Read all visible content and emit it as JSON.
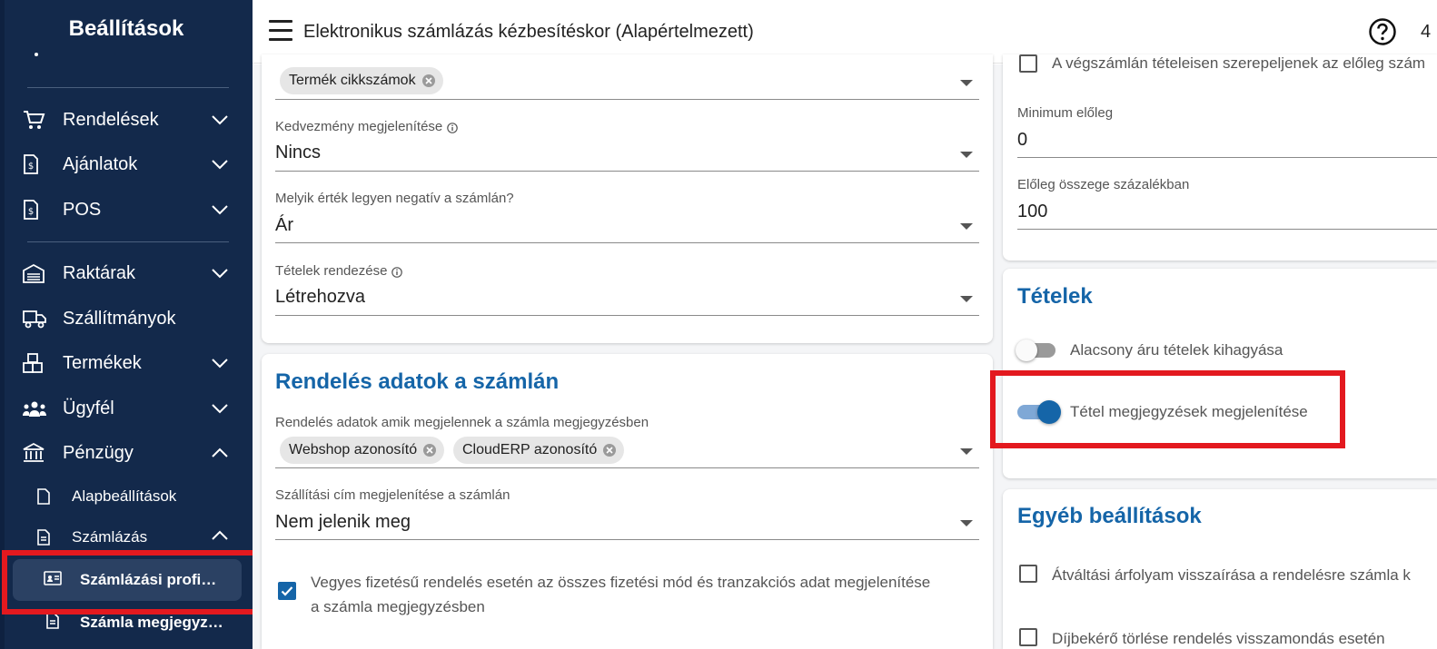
{
  "sidebar": {
    "title": "Beállítások",
    "items": [
      {
        "label": "Rendelések",
        "icon": "cart-icon",
        "expanded": false
      },
      {
        "label": "Ajánlatok",
        "icon": "document-dollar-icon",
        "expanded": false
      },
      {
        "label": "POS",
        "icon": "pos-icon",
        "expanded": false
      },
      {
        "label": "Raktárak",
        "icon": "warehouse-icon",
        "expanded": false
      },
      {
        "label": "Szállítmányok",
        "icon": "truck-icon"
      },
      {
        "label": "Termékek",
        "icon": "boxes-icon",
        "expanded": false
      },
      {
        "label": "Ügyfél",
        "icon": "users-icon",
        "expanded": false
      },
      {
        "label": "Pénzügy",
        "icon": "bank-icon",
        "expanded": true
      }
    ],
    "finance_children": [
      {
        "label": "Alapbeállítások",
        "icon": "file-icon"
      },
      {
        "label": "Számlázás",
        "icon": "file-text-icon",
        "expanded": true
      }
    ],
    "billing_children": [
      {
        "label": "Számlázási profi…",
        "icon": "id-card-icon",
        "active": true
      },
      {
        "label": "Számla megjegyz…",
        "icon": "file-text-icon",
        "active": false
      }
    ]
  },
  "topbar": {
    "title": "Elektronikus számlázás kézbesítéskor (Alapértelmezett)",
    "clipped_text": "4"
  },
  "left_card": {
    "top_chip": "Termék cikkszámok",
    "fields": [
      {
        "label": "Kedvezmény megjelenítése",
        "value": "Nincs",
        "info": true
      },
      {
        "label": "Melyik érték legyen negatív a számlán?",
        "value": "Ár",
        "info": false
      },
      {
        "label": "Tételek rendezése",
        "value": "Létrehozva",
        "info": true
      }
    ]
  },
  "order_card": {
    "title": "Rendelés adatok a számlán",
    "notes_label": "Rendelés adatok amik megjelennek a számla megjegyzésben",
    "chips": [
      "Webshop azonosító",
      "CloudERP azonosító"
    ],
    "shipping_label": "Szállítási cím megjelenítése a számlán",
    "shipping_value": "Nem jelenik meg",
    "mixed_payment_text_line1": "Vegyes fizetésű rendelés esetén az összes fizetési mód és tranzakciós adat megjelenítése",
    "mixed_payment_text_line2": "a számla megjegyzésben",
    "mixed_payment_checked": true
  },
  "right_top_card": {
    "clipped_checkbox_text": "A végszámlán tételeisen szerepeljenek az előleg szám",
    "min_advance_label": "Minimum előleg",
    "min_advance_value": "0",
    "advance_percent_label": "Előleg összege százalékban",
    "advance_percent_value": "100"
  },
  "items_card": {
    "title": "Tételek",
    "toggle1_label": "Alacsony áru tételek kihagyása",
    "toggle1_on": false,
    "toggle2_label": "Tétel megjegyzések megjelenítése",
    "toggle2_on": true
  },
  "other_card": {
    "title": "Egyéb beállítások",
    "checkbox1_label": "Átváltási árfolyam visszaírása a rendelésre számla k",
    "checkbox2_label": "Díjbekérő törlése rendelés visszamondás esetén"
  },
  "colors": {
    "sidebar_bg": "#13294b",
    "accent": "#1565a8",
    "highlight": "#e3191f"
  }
}
